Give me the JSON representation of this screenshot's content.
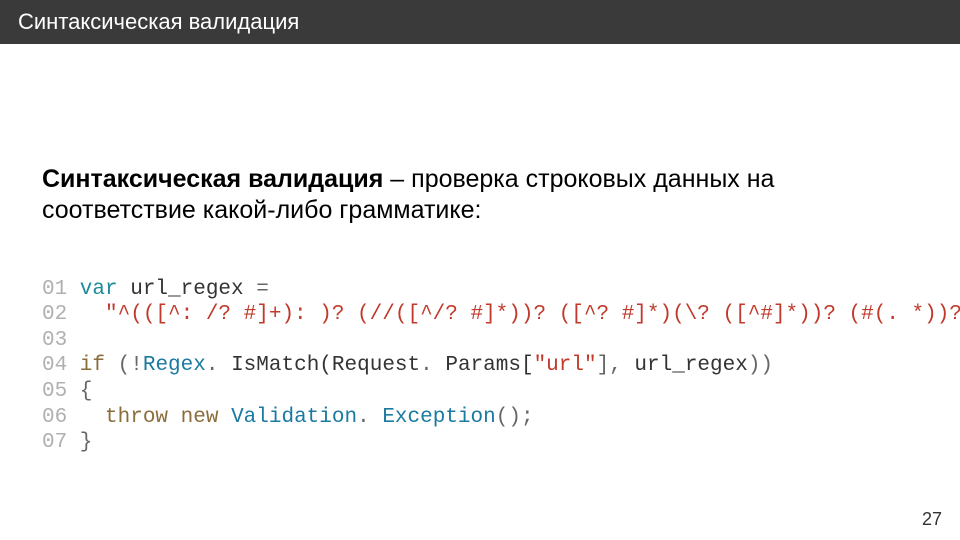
{
  "header": {
    "title": "Синтаксическая валидация"
  },
  "definition": {
    "bold": "Синтаксическая валидация",
    "rest": " – проверка строковых данных на соответствие какой-либо грамматике:"
  },
  "code": {
    "lines": {
      "l1_num": "01",
      "l1_var": "var",
      "l1_sp1": " ",
      "l1_ident": "url_regex",
      "l1_sp2": " ",
      "l1_eq": "=",
      "l2_num": "02",
      "l2_indent": "  ",
      "l2_str": "\"^(([^: /? #]+): )? (//([^/? #]*))? ([^? #]*)(\\? ([^#]*))? (#(. *))? \"",
      "l2_semi": ";",
      "l3_num": "03",
      "l4_num": "04",
      "l4_if": "if",
      "l4_sp1": " ",
      "l4_p1": "(!",
      "l4_regex": "Regex",
      "l4_dot1": ". ",
      "l4_ism": "Is",
      "l4_match": "Match(Request",
      "l4_dot2": ". ",
      "l4_params": "Params[",
      "l4_url": "\"url\"",
      "l4_brclose": "]",
      "l4_comma": ", ",
      "l4_ur": "url_regex",
      "l4_close": "))",
      "l5_num": "05",
      "l5_brace": "{",
      "l6_num": "06",
      "l6_indent": "  ",
      "l6_throw": "throw",
      "l6_sp1": " ",
      "l6_new": "new",
      "l6_sp2": " ",
      "l6_validation": "Validation",
      "l6_dot": ". ",
      "l6_exc": "Exception",
      "l6_paren": "();",
      "l7_num": "07",
      "l7_brace": "}"
    }
  },
  "page": {
    "number": "27"
  }
}
